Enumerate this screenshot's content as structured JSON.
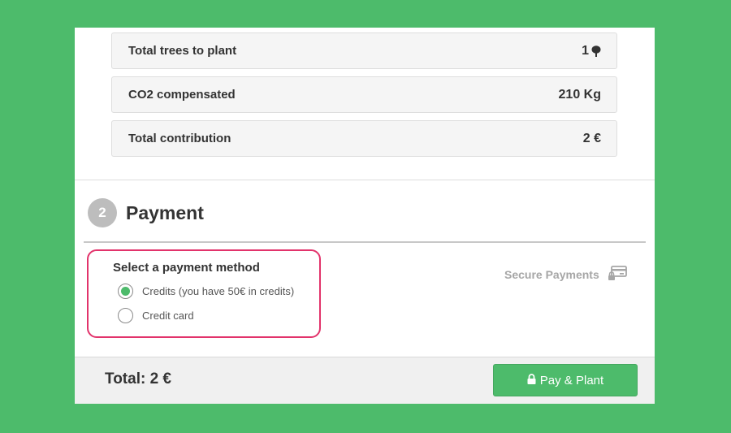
{
  "summary": {
    "rows": [
      {
        "label": "Total trees to plant",
        "value": "1",
        "icon": "tree-icon"
      },
      {
        "label": "CO2 compensated",
        "value": "210 Kg"
      },
      {
        "label": "Total contribution",
        "value": "2 €"
      }
    ]
  },
  "payment": {
    "step_number": "2",
    "title": "Payment",
    "method_title": "Select a payment method",
    "options": [
      {
        "label": "Credits (you have 50€ in credits)",
        "selected": true
      },
      {
        "label": "Credit card",
        "selected": false
      }
    ],
    "secure_label": "Secure Payments",
    "secure_icon": "secure-card-icon"
  },
  "footer": {
    "total_label": "Total: 2 €",
    "pay_button_label": "Pay & Plant",
    "pay_icon": "lock-icon"
  },
  "colors": {
    "background": "#4dbb6b",
    "accent": "#4dbb6b",
    "highlight_border": "#e2336b",
    "step_circle": "#bdbdbd"
  }
}
